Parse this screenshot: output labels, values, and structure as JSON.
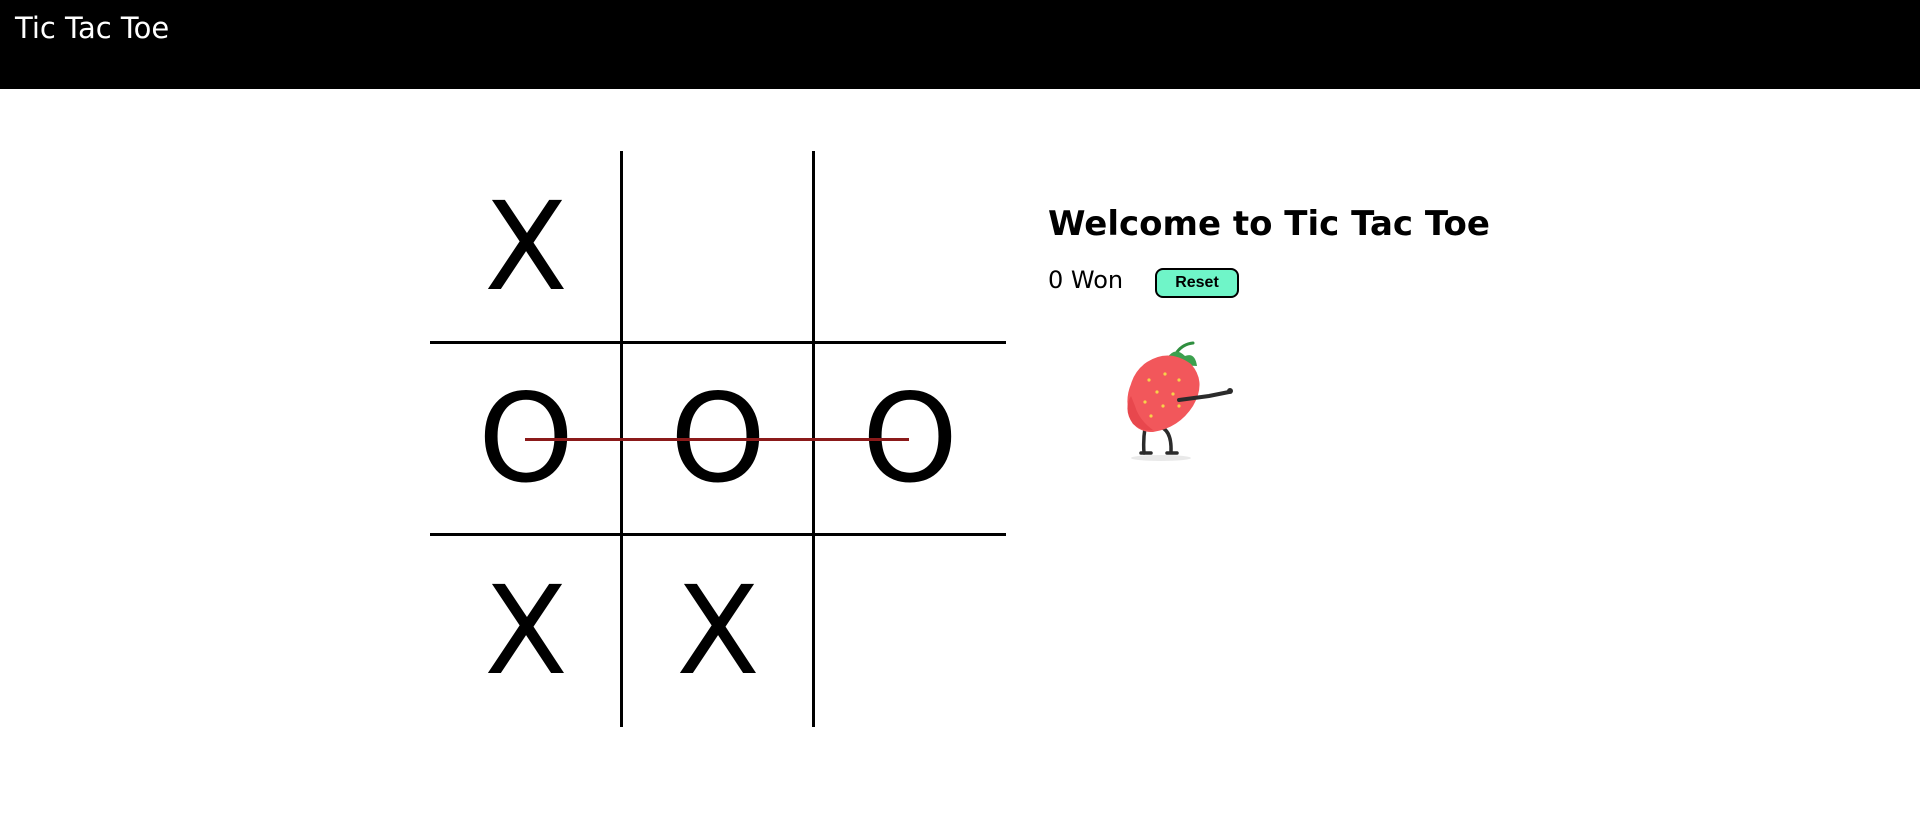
{
  "header": {
    "title": "Tic Tac Toe"
  },
  "board": {
    "cells": [
      {
        "value": "X"
      },
      {
        "value": ""
      },
      {
        "value": ""
      },
      {
        "value": "O"
      },
      {
        "value": "O"
      },
      {
        "value": "O"
      },
      {
        "value": "X"
      },
      {
        "value": "X"
      },
      {
        "value": ""
      }
    ],
    "winning_line": "middle-row",
    "winning_line_color": "#8b1a1a"
  },
  "info": {
    "welcome": "Welcome to Tic Tac Toe",
    "status": "0 Won",
    "reset_label": "Reset",
    "reset_color": "#6ff5c8",
    "mascot_icon": "strawberry-dab-icon"
  }
}
